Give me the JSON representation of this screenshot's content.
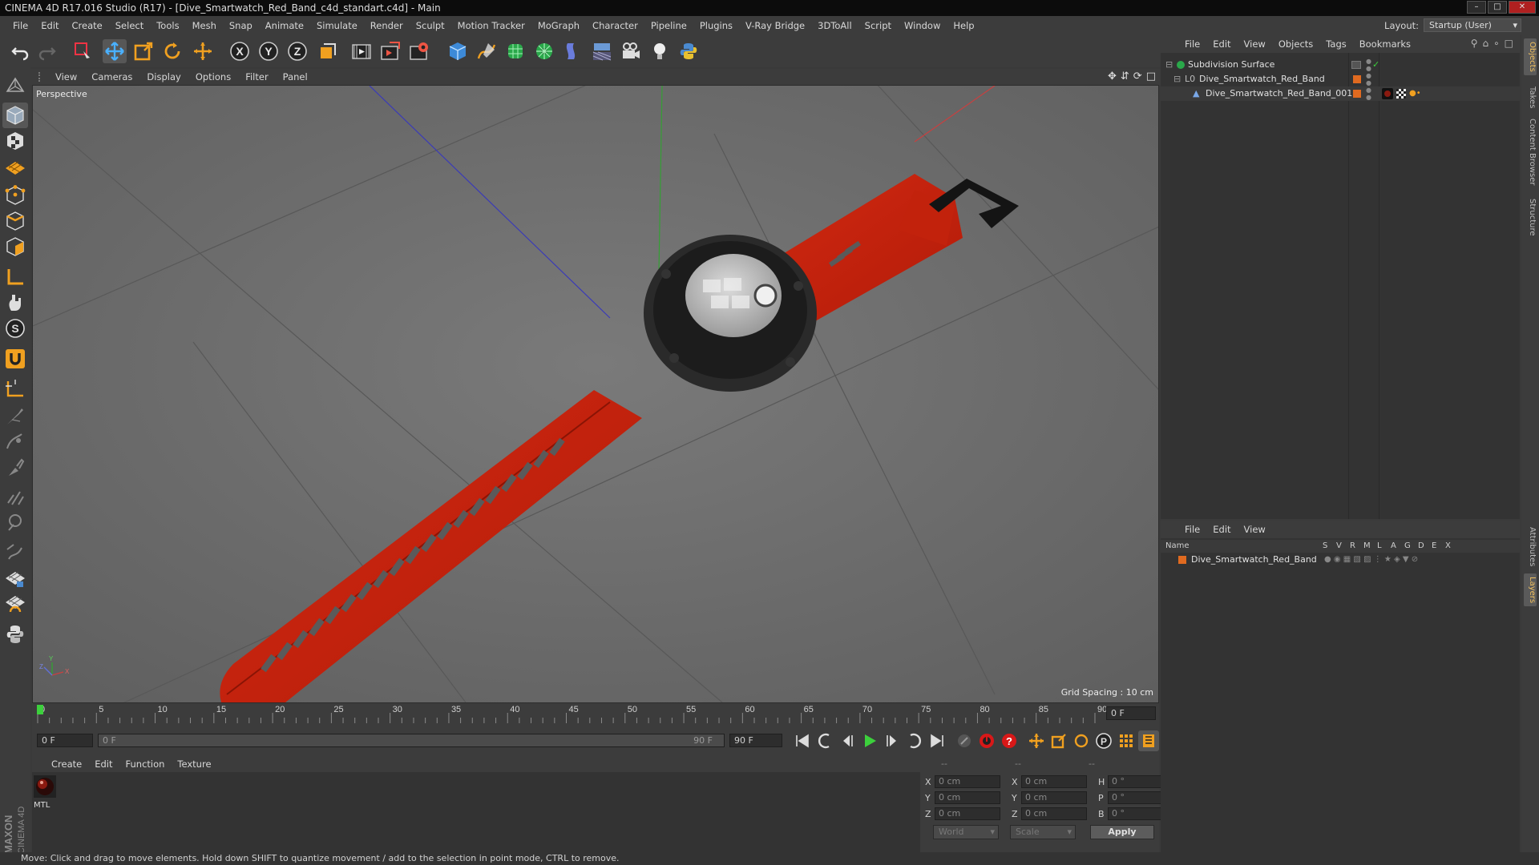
{
  "window": {
    "title": "CINEMA 4D R17.016 Studio (R17) - [Dive_Smartwatch_Red_Band_c4d_standart.c4d] - Main"
  },
  "menubar": {
    "items": [
      "File",
      "Edit",
      "Create",
      "Select",
      "Tools",
      "Mesh",
      "Snap",
      "Animate",
      "Simulate",
      "Render",
      "Sculpt",
      "Motion Tracker",
      "MoGraph",
      "Character",
      "Pipeline",
      "Plugins",
      "V-Ray Bridge",
      "3DToAll",
      "Script",
      "Window",
      "Help"
    ],
    "layout_label": "Layout:",
    "layout_value": "Startup (User)"
  },
  "toolbar": {
    "icons": [
      "undo-icon",
      "redo-icon",
      "live-selection-icon",
      "move-icon",
      "scale-icon",
      "rotate-icon",
      "last-tool-icon",
      "x-axis-icon",
      "y-axis-icon",
      "z-axis-icon",
      "world-coord-icon",
      "render-view-icon",
      "render-picture-viewer-icon",
      "edit-render-settings-icon",
      "cube-icon",
      "pen-spline-icon",
      "subdivision-surface-icon",
      "cloner-icon",
      "deformer-icon",
      "floor-icon",
      "camera-icon",
      "light-icon",
      "python-icon"
    ],
    "axis_letters": [
      "X",
      "Y",
      "Z"
    ]
  },
  "lefttools": {
    "icons": [
      "make-editable-icon",
      "model-mode-icon",
      "texture-mode-icon",
      "workplane-mode-icon",
      "points-mode-icon",
      "edges-mode-icon",
      "polygons-mode-icon",
      "axis-mode-icon",
      "tweak-mode-icon",
      "solo-icon",
      "magnet-icon",
      "workplane-icon",
      "knife-icon",
      "bridge-icon",
      "brush-icon",
      "iron-icon",
      "smooth-icon",
      "cloth-icon",
      "lock-workplane-icon",
      "grid-snap-icon",
      "python-icon"
    ],
    "solo_letter": "S"
  },
  "viewport": {
    "menu": [
      "View",
      "Cameras",
      "Display",
      "Options",
      "Filter",
      "Panel"
    ],
    "label": "Perspective",
    "grid_spacing": "Grid Spacing : 10 cm",
    "axis_labels": {
      "z": "Z",
      "y": "Y",
      "x": "X"
    }
  },
  "timeline": {
    "ticks": [
      "0",
      "5",
      "10",
      "15",
      "20",
      "25",
      "30",
      "35",
      "40",
      "45",
      "50",
      "55",
      "60",
      "65",
      "70",
      "75",
      "80",
      "85",
      "90"
    ],
    "current_frame": "0 F",
    "playhead": 0,
    "end": 90
  },
  "transport": {
    "start_field": "0 F",
    "range_start": "0 F",
    "range_end": "90 F",
    "end_field": "90 F"
  },
  "material_manager": {
    "menu": [
      "Create",
      "Edit",
      "Function",
      "Texture"
    ],
    "materials": [
      {
        "name": "MTL"
      }
    ]
  },
  "coordinates": {
    "headers": [
      "--",
      "--",
      "--"
    ],
    "rows": [
      {
        "pos_label": "X",
        "pos": "0 cm",
        "size_label": "X",
        "size": "0 cm",
        "rot_label": "H",
        "rot": "0 °"
      },
      {
        "pos_label": "Y",
        "pos": "0 cm",
        "size_label": "Y",
        "size": "0 cm",
        "rot_label": "P",
        "rot": "0 °"
      },
      {
        "pos_label": "Z",
        "pos": "0 cm",
        "size_label": "Z",
        "size": "0 cm",
        "rot_label": "B",
        "rot": "0 °"
      }
    ],
    "mode_select": "World",
    "size_select": "Scale",
    "apply": "Apply"
  },
  "object_manager": {
    "menu": [
      "File",
      "Edit",
      "View",
      "Objects",
      "Tags",
      "Bookmarks"
    ],
    "objects": [
      {
        "name": "Subdivision Surface",
        "indent": 0
      },
      {
        "name": "Dive_Smartwatch_Red_Band",
        "indent": 1
      },
      {
        "name": "Dive_Smartwatch_Red_Band_001",
        "indent": 2
      }
    ]
  },
  "layer_manager": {
    "menu": [
      "File",
      "Edit",
      "View"
    ],
    "columns": [
      "Name",
      "S",
      "V",
      "R",
      "M",
      "L",
      "A",
      "G",
      "D",
      "E",
      "X"
    ],
    "layers": [
      {
        "name": "Dive_Smartwatch_Red_Band"
      }
    ]
  },
  "right_tabs": [
    "Objects",
    "Takes",
    "Content Browser",
    "Structure",
    "Attributes",
    "Layers"
  ],
  "statusbar": {
    "text": "Move: Click and drag to move elements. Hold down SHIFT to quantize movement / add to the selection in point mode, CTRL to remove."
  },
  "colors": {
    "accent_orange": "#f0a020",
    "band_red": "#c8200e",
    "viewport_bg": "#6a6a6a",
    "layer_color": "#e06a20"
  }
}
